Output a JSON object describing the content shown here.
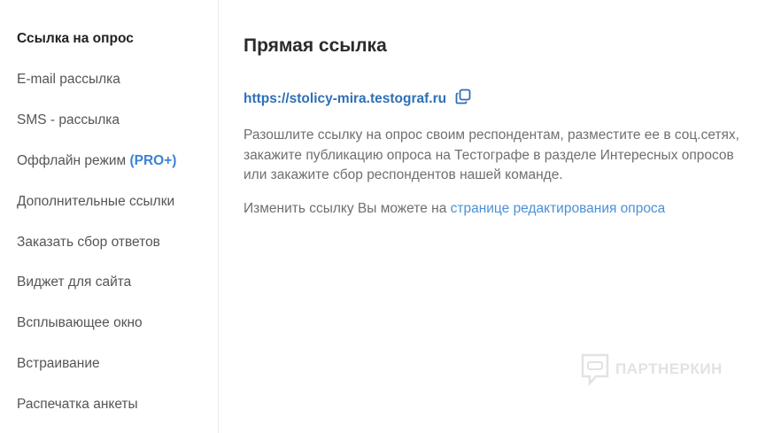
{
  "sidebar": {
    "items": [
      {
        "label": "Ссылка на опрос",
        "active": true
      },
      {
        "label": "E-mail рассылка"
      },
      {
        "label": "SMS - рассылка"
      },
      {
        "label": "Оффлайн режим",
        "badge": "(PRO+)"
      },
      {
        "label": "Дополнительные ссылки"
      },
      {
        "label": "Заказать сбор ответов"
      },
      {
        "label": "Виджет для сайта"
      },
      {
        "label": "Всплывающее окно"
      },
      {
        "label": "Встраивание"
      },
      {
        "label": "Распечатка анкеты"
      }
    ]
  },
  "main": {
    "title": "Прямая ссылка",
    "link": "https://stolicy-mira.testograf.ru",
    "copy_icon": "copy-icon",
    "description": "Разошлите ссылку на опрос своим респондентам, разместите ее в соц.сетях, закажите публикацию опроса на Тестографе в разделе Интересных опросов или закажите сбор респондентов нашей команде.",
    "change_text": "Изменить ссылку Вы можете на ",
    "change_link": "странице редактирования опроса"
  },
  "watermark": {
    "text": "ПАРТНЕРКИН"
  },
  "colors": {
    "accent": "#2f6fb5",
    "link": "#4a90d6",
    "pro": "#3b82d6"
  }
}
